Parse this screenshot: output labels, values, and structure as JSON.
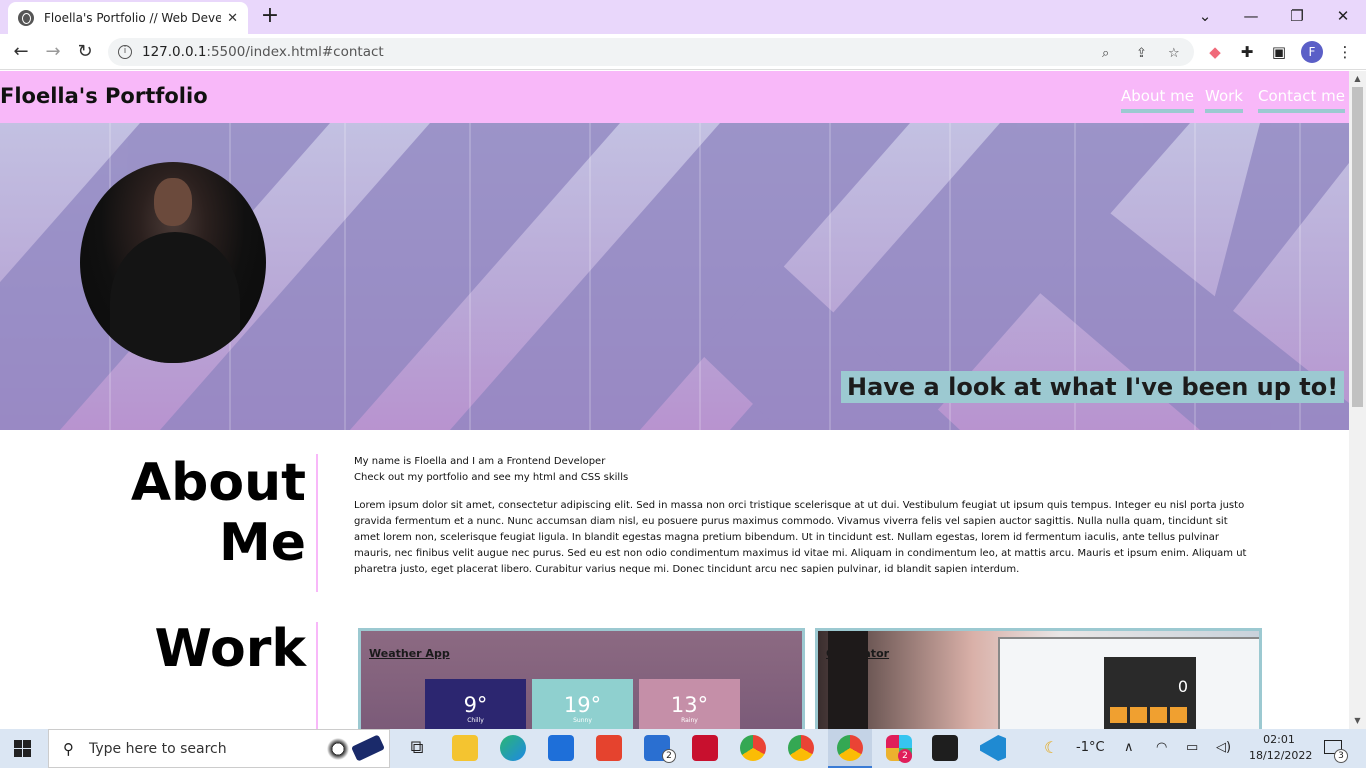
{
  "browser": {
    "tab_title": "Floella's Portfolio // Web Develop",
    "url_host": "127.0.0.1",
    "url_rest": ":5500/index.html#contact",
    "profile_initial": "F"
  },
  "site": {
    "brand": "Floella's Portfolio",
    "nav": [
      "About me",
      "Work",
      "Contact me"
    ],
    "tagline": "Have a look at what I've been up to!",
    "accent_pink": "#f8b8f9",
    "accent_blue": "#9cc9d1"
  },
  "about": {
    "title_line1": "About",
    "title_line2": "Me",
    "intro1": "My name is Floella and I am a Frontend Developer",
    "intro2": "Check out my portfolio and see my html and CSS skills",
    "body": "Lorem ipsum dolor sit amet, consectetur adipiscing elit. Sed in massa non orci tristique scelerisque at ut dui. Vestibulum feugiat ut ipsum quis tempus. Integer eu nisl porta justo gravida fermentum et a nunc. Nunc accumsan diam nisl, eu posuere purus maximus commodo. Vivamus viverra felis vel sapien auctor sagittis. Nulla nulla quam, tincidunt sit amet lorem non, scelerisque feugiat ligula. In blandit egestas magna pretium bibendum. Ut in tincidunt est. Nullam egestas, lorem id fermentum iaculis, ante tellus pulvinar mauris, nec finibus velit augue nec purus. Sed eu est non odio condimentum maximus id vitae mi. Aliquam in condimentum leo, at mattis arcu. Mauris et ipsum enim. Aliquam ut pharetra justo, eget placerat libero. Curabitur varius neque mi. Donec tincidunt arcu nec sapien pulvinar, id blandit sapien interdum."
  },
  "work": {
    "title": "Work",
    "projects": [
      {
        "label": "Weather App",
        "tiles": [
          {
            "temp": "9°",
            "cond": "Chilly"
          },
          {
            "temp": "19°",
            "cond": "Sunny"
          },
          {
            "temp": "13°",
            "cond": "Rainy"
          }
        ]
      },
      {
        "label": "Calculator",
        "display": "0"
      }
    ]
  },
  "taskbar": {
    "search_placeholder": "Type here to search",
    "mail_badge": "2",
    "slack_badge": "2",
    "temperature": "-1°C",
    "time": "02:01",
    "date": "18/12/2022",
    "notifications": "3"
  }
}
